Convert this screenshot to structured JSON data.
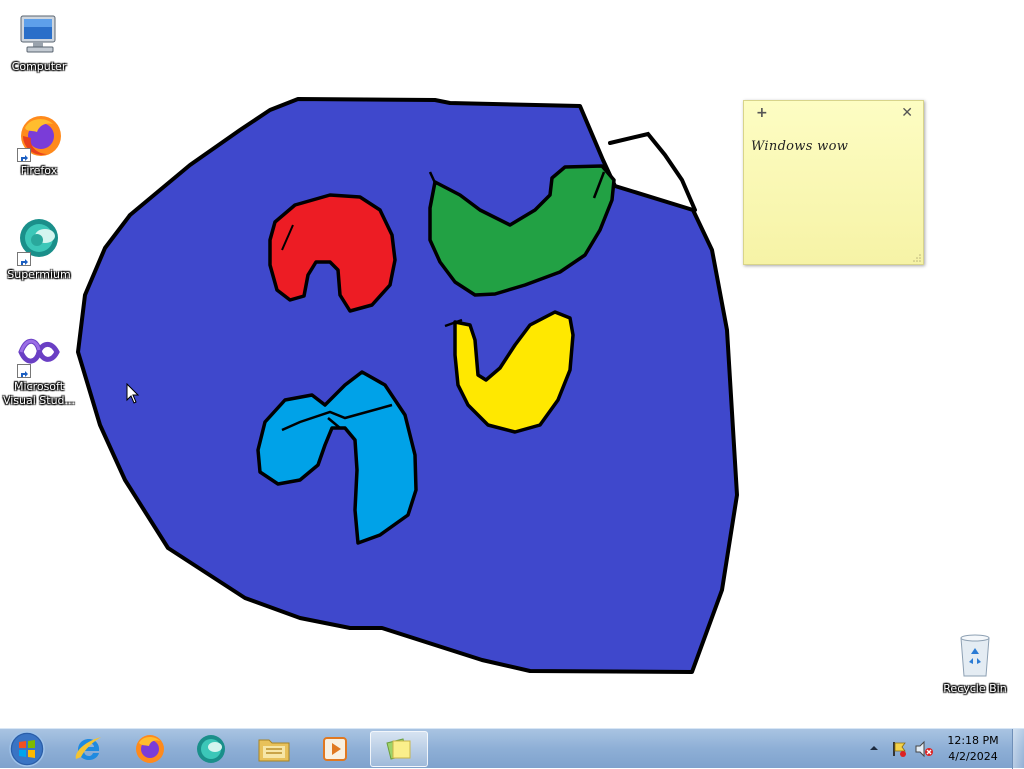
{
  "desktop": {
    "icons": [
      {
        "label": "Computer"
      },
      {
        "label": "Firefox"
      },
      {
        "label": "Supermium"
      },
      {
        "label": "Microsoft Visual Stud..."
      },
      {
        "label": "Recycle Bin"
      }
    ]
  },
  "sticky_note": {
    "text": "Windows wow",
    "add_icon": "plus-icon",
    "close_icon": "close-icon"
  },
  "taskbar": {
    "pinned": [
      {
        "name": "Internet Explorer"
      },
      {
        "name": "Firefox"
      },
      {
        "name": "Supermium"
      },
      {
        "name": "Windows Explorer"
      },
      {
        "name": "Windows Media Player"
      },
      {
        "name": "Sticky Notes",
        "active": true
      }
    ],
    "tray": {
      "time": "12:18 PM",
      "date": "4/2/2024"
    }
  },
  "colors": {
    "blob_blue": "#3f48cc",
    "red": "#ed1c24",
    "green": "#22a144",
    "yellow": "#ffe800",
    "light_blue": "#00a2e8",
    "sticky_yellow": "#fcf9b4"
  }
}
